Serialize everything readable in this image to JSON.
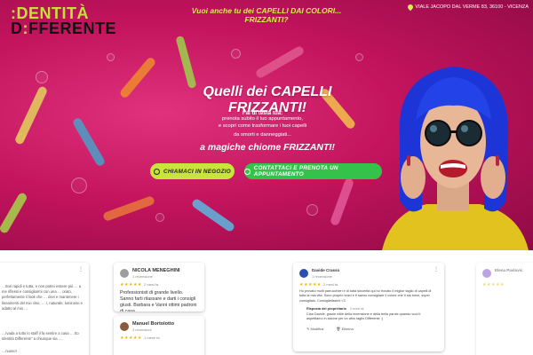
{
  "header": {
    "logo_line1": ":DENTITÀ",
    "logo_line2_prefix": "D",
    "logo_line2_mid": ":",
    "logo_line2_rest": "FFERENTE",
    "tagline": "Vuoi anche tu dei CAPELLI DAI COLORI... FRIZZANTI?",
    "address": "VIALE JACOPO DAL VERME 83, 36100 - VICENZA"
  },
  "hero": {
    "headline": "Quelli dei  CAPELLI FRIZZANTI!",
    "sub_bold": "Fai di testa tua:",
    "sub_line1": "prenota subito il tuo appuntamento,",
    "sub_line2": "e scopri come trasformare i tuoi capelli",
    "sub_line3": "da smorti e danneggiati...",
    "big_line": "a magiche chiome FRIZZANTI!",
    "btn_call": "CHIAMACI IN NEGOZIO",
    "btn_wa": "CONTATTACI E PRENOTA UN APPUNTAMENTO"
  },
  "reviews": [
    {
      "text": "…ttori rapidi e tutta, e non potrei essere più … a me riflessi e consigliarmi con una … orato, perfettamente il look che … devi e mantenere i lineamenti del mio viso, … i, naturale, luminoso e adatto al mio …",
      "text2": "…Ivada a tutto lo staff il fa sentire a casa … tto Identità Differente\" a chiunque sia …",
      "text3": "…nuovo!"
    },
    {
      "name": "NICOLA MENEGHINI",
      "count": "1 recensione",
      "stars": "★★★★★",
      "time": "2 mesi fa",
      "text": "Professionisti di grande livello. Sanno farti rilassare e darti i consigli giusti. Barbara e Vanni ottimi padroni di casa"
    },
    {
      "name": "Manuel Bortolotto",
      "count": "3 recensioni",
      "stars": "★★★★★",
      "time": "1 mese fa"
    },
    {
      "name": "Davide Crasso",
      "count": "1 recensione",
      "stars": "★★★★★",
      "time": "2 mesi fa",
      "text": "Ho provato molti parrucchieri e di tutta sincerità qui ho trovato il miglior taglio di capelli di tutta la mia vita. Sono proprio bravi e ti sanno consigliare il colore che ti sta bene, super consigliato. Consigliatissimi <3",
      "owner_title": "Risposta del proprietario",
      "owner_time": "2 mesi fa",
      "owner_text": "Ciao Davide, grazie mille della recensione e della bella parole quando vuoi ti aspettiamo in salone per un altro taglio Differente :)",
      "action1": "Modifica",
      "action2": "Elimina"
    },
    {
      "name": "Elena Pavlovic"
    }
  ]
}
